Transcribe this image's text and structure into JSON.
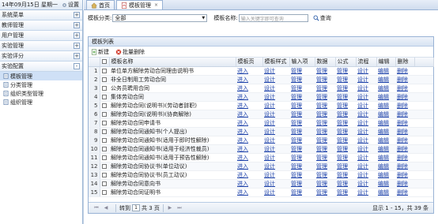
{
  "header": {
    "date_text": "14年09月15日 星期一",
    "settings_label": "设置"
  },
  "sidebar": {
    "sections": [
      {
        "label": "系统菜单",
        "toggle": "+"
      },
      {
        "label": "教师管理",
        "toggle": "+"
      },
      {
        "label": "用户管理",
        "toggle": "+"
      },
      {
        "label": "实验管理",
        "toggle": "+"
      },
      {
        "label": "实验评分",
        "toggle": "+"
      },
      {
        "label": "实验配置",
        "toggle": "-"
      }
    ],
    "subitems": [
      {
        "label": "模板管理",
        "active": true
      },
      {
        "label": "分类管理",
        "active": false
      },
      {
        "label": "组织类型管理",
        "active": false
      },
      {
        "label": "组织管理",
        "active": false
      }
    ]
  },
  "tabs": [
    {
      "label": "首页",
      "icon": "home-icon",
      "active": false
    },
    {
      "label": "模板管理",
      "icon": "pdf-icon",
      "active": true,
      "close": "×"
    }
  ],
  "search": {
    "category_label": "模板分类:",
    "category_value": "全部",
    "name_label": "模板名称:",
    "name_placeholder": "输入关键字即可查询",
    "query_label": "查询"
  },
  "panel": {
    "title": "模板列表",
    "new_label": "新建",
    "batch_delete_label": "批量删除"
  },
  "table": {
    "columns": [
      "模板名称",
      "模板页",
      "模板样式",
      "输入项",
      "数据",
      "公式",
      "流程",
      "编辑",
      "删除"
    ],
    "link_labels": [
      "进入",
      "设计",
      "管理",
      "管理",
      "管理",
      "设计",
      "编辑",
      "删除"
    ],
    "rows": [
      {
        "num": "1",
        "name": "单位单方解除劳动合同理由说明书"
      },
      {
        "num": "2",
        "name": "非全日制用工劳动合同"
      },
      {
        "num": "3",
        "name": "公务员聘用合同"
      },
      {
        "num": "4",
        "name": "集体劳动合同"
      },
      {
        "num": "5",
        "name": "解除劳动合同(说明书)(劳动者辞职)"
      },
      {
        "num": "6",
        "name": "解除劳动合同(说明书)(协商解除)"
      },
      {
        "num": "7",
        "name": "解除劳动合同申请书"
      },
      {
        "num": "8",
        "name": "解除劳动合同通知书(个人提出)"
      },
      {
        "num": "9",
        "name": "解除劳动合同通知书(适用于即时性解除)"
      },
      {
        "num": "10",
        "name": "解除劳动合同通知书(适用于经济性裁员)"
      },
      {
        "num": "11",
        "name": "解除劳动合同通知书(适用于预告性解除)"
      },
      {
        "num": "12",
        "name": "解除劳动合同协议书(单位动议)"
      },
      {
        "num": "13",
        "name": "解除劳动合同协议书(员工动议)"
      },
      {
        "num": "14",
        "name": "解除劳动合同意向书"
      },
      {
        "num": "15",
        "name": "解除劳动合同证明书"
      }
    ]
  },
  "pager": {
    "goto_label": "转到",
    "current_page": "1",
    "total_pages_text": "共 3 页",
    "info": "显示 1 - 15，共 39 条",
    "first": "⏮",
    "prev": "◀",
    "next": "▶",
    "last": "⏭"
  },
  "colors": {
    "link": "#1a3fa8",
    "accent_border": "#99b3d5",
    "active_item": "#cfe0f6"
  }
}
